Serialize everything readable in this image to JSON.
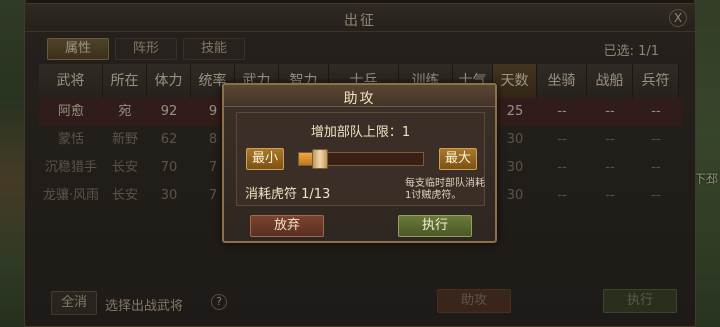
{
  "window": {
    "title": "出征",
    "close_label": "X",
    "selected_count": "已选: 1/1"
  },
  "tabs": [
    {
      "label": "属性"
    },
    {
      "label": "阵形"
    },
    {
      "label": "技能"
    }
  ],
  "table": {
    "headers": [
      "武将",
      "所在",
      "体力",
      "统率",
      "武力",
      "智力",
      "士兵",
      "训练",
      "士气",
      "天数",
      "坐骑",
      "战船",
      "兵符"
    ],
    "rows": [
      [
        "阿愈",
        "宛",
        "92",
        "9",
        "",
        "",
        "",
        "",
        "",
        "25",
        "--",
        "--",
        "--"
      ],
      [
        "蒙恬",
        "新野",
        "62",
        "8",
        "",
        "",
        "",
        "",
        "",
        "30",
        "--",
        "--",
        "--"
      ],
      [
        "沉稳猎手",
        "长安",
        "70",
        "7",
        "",
        "",
        "",
        "",
        "",
        "30",
        "--",
        "--",
        "--"
      ],
      [
        "龙骧·风雨",
        "长安",
        "30",
        "7",
        "",
        "",
        "",
        "",
        "",
        "30",
        "--",
        "--",
        "--"
      ]
    ]
  },
  "footer": {
    "select_all": "全消",
    "hint": "选择出战武将",
    "help": "?",
    "assist": "助攻",
    "execute": "执行"
  },
  "dialog": {
    "title": "助攻",
    "limit_text": "增加部队上限：1",
    "min_label": "最小",
    "max_label": "最大",
    "slider_value": 1,
    "slider_max": 13,
    "cost_text": "消耗虎符 1/13",
    "note_text": "每支临时部队消耗1讨贼虎符。",
    "giveup_label": "放弃",
    "execute_label": "执行"
  },
  "map_side_label": "下邳"
}
